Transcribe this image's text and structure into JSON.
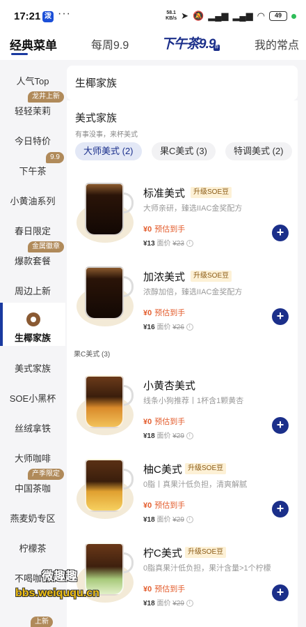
{
  "status_bar": {
    "time": "17:21",
    "app_badge": "泼",
    "more": "···",
    "net_speed_value": "58.1",
    "net_speed_unit": "KB/s",
    "battery": "49"
  },
  "top_tabs": [
    {
      "label": "经典菜单",
      "active": true
    },
    {
      "label": "每周9.9",
      "active": false
    },
    {
      "label": "下午茶9.9",
      "active": false
    },
    {
      "label": "我的常点",
      "active": false
    }
  ],
  "sidebar": {
    "items": [
      {
        "label": "人气Top",
        "badge": ""
      },
      {
        "label": "轻轻茉莉",
        "badge": "龙井上新"
      },
      {
        "label": "今日特价",
        "badge": ""
      },
      {
        "label": "下午茶",
        "badge": "9.9"
      },
      {
        "label": "小黄油系列",
        "badge": ""
      },
      {
        "label": "春日限定",
        "badge": ""
      },
      {
        "label": "爆款套餐",
        "badge": "金属徽章"
      },
      {
        "label": "周边上新",
        "badge": ""
      },
      {
        "label": "生椰家族",
        "badge": "",
        "active": true
      },
      {
        "label": "美式家族",
        "badge": ""
      },
      {
        "label": "SOE小黑杯",
        "badge": ""
      },
      {
        "label": "丝绒拿铁",
        "badge": ""
      },
      {
        "label": "大师咖啡",
        "badge": ""
      },
      {
        "label": "中国茶咖",
        "badge": "产季限定"
      },
      {
        "label": "燕麦奶专区",
        "badge": ""
      },
      {
        "label": "柠檬茶",
        "badge": ""
      },
      {
        "label": "不喝咖啡",
        "badge": ""
      },
      {
        "label": "",
        "badge": "上新"
      }
    ]
  },
  "main": {
    "family_header": "生椰家族",
    "section_title": "美式家族",
    "section_subtitle": "有事没事，来杯美式",
    "chips": [
      {
        "label": "大师美式 (2)",
        "active": true
      },
      {
        "label": "果C美式 (3)",
        "active": false
      },
      {
        "label": "特调美式 (2)",
        "active": false
      }
    ],
    "group_label": "果C美式 (3)",
    "products": [
      {
        "name": "标准美式",
        "tag": "升级SOE豆",
        "desc": "大师亲研，臻选IIAC金奖配方",
        "price": "¥0",
        "price_note": "预估到手",
        "now": "¥13",
        "orig_label": "面价",
        "orig": "¥23",
        "cup": "black"
      },
      {
        "name": "加浓美式",
        "tag": "升级SOE豆",
        "desc": "浓醇加倍，臻选IIAC金奖配方",
        "price": "¥0",
        "price_note": "预估到手",
        "now": "¥16",
        "orig_label": "面价",
        "orig": "¥26",
        "cup": "black"
      },
      {
        "name": "小黄杏美式",
        "tag": "",
        "desc": "线条小狗推荐丨1杯含1颗黄杏",
        "price": "¥0",
        "price_note": "预估到手",
        "now": "¥18",
        "orig_label": "面价",
        "orig": "¥29",
        "cup": "apricot"
      },
      {
        "name": "柚C美式",
        "tag": "升级SOE豆",
        "desc": "0脂丨真果汁低负担，清爽解腻",
        "price": "¥0",
        "price_note": "预估到手",
        "now": "¥18",
        "orig_label": "面价",
        "orig": "¥29",
        "cup": "yuzu"
      },
      {
        "name": "柠C美式",
        "tag": "升级SOE豆",
        "desc": "0脂真果汁低负担，果汁含量>1个柠檬",
        "price": "¥0",
        "price_note": "预估到手",
        "now": "¥18",
        "orig_label": "面价",
        "orig": "¥29",
        "cup": "lime"
      }
    ],
    "add_symbol": "+",
    "info_symbol": "i"
  },
  "watermark": {
    "title": "微趣趣",
    "url": "bbs.weiququ.cn"
  }
}
